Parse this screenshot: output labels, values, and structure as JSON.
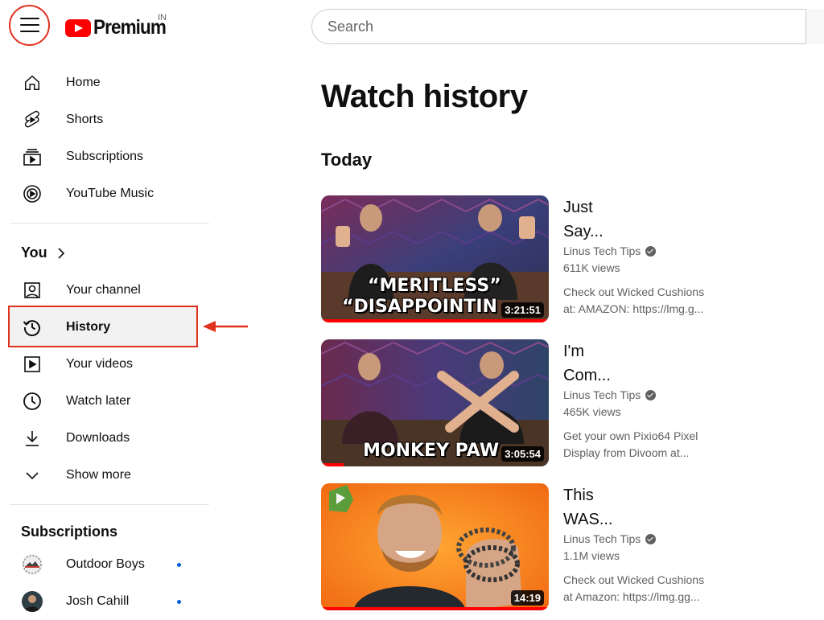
{
  "header": {
    "logo_text": "Premium",
    "country_code": "IN",
    "search_placeholder": "Search"
  },
  "sidebar": {
    "main_items": [
      {
        "label": "Home",
        "icon": "home-icon"
      },
      {
        "label": "Shorts",
        "icon": "shorts-icon"
      },
      {
        "label": "Subscriptions",
        "icon": "subscriptions-icon"
      },
      {
        "label": "YouTube Music",
        "icon": "youtube-music-icon"
      }
    ],
    "you_title": "You",
    "you_items": [
      {
        "label": "Your channel",
        "icon": "your-channel-icon"
      },
      {
        "label": "History",
        "icon": "history-icon"
      },
      {
        "label": "Your videos",
        "icon": "your-videos-icon"
      },
      {
        "label": "Watch later",
        "icon": "watch-later-icon"
      },
      {
        "label": "Downloads",
        "icon": "download-icon"
      },
      {
        "label": "Show more",
        "icon": "chevron-down-icon"
      }
    ],
    "subscriptions_title": "Subscriptions",
    "subscriptions": [
      {
        "name": "Outdoor Boys",
        "new_content": true
      },
      {
        "name": "Josh Cahill",
        "new_content": true
      }
    ]
  },
  "main": {
    "title": "Watch history",
    "group_label": "Today",
    "videos": [
      {
        "title_line1": "Just",
        "title_line2": "Say...",
        "channel": "Linus Tech Tips",
        "views": "611K views",
        "desc_line1": "Check out Wicked Cushions",
        "desc_line2": "at: AMAZON: https://lmg.g...",
        "duration": "3:21:51",
        "caption_line1": "“MERITLESS”",
        "caption_line2": "“DISAPPOINTIN",
        "progress": 1.0
      },
      {
        "title_line1": "I'm",
        "title_line2": "Com...",
        "channel": "Linus Tech Tips",
        "views": "465K views",
        "desc_line1": "Get your own Pixio64 Pixel",
        "desc_line2": "Display from Divoom at...",
        "duration": "3:05:54",
        "caption_line1": "MONKEY PAW",
        "caption_line2": "",
        "progress": 0.1
      },
      {
        "title_line1": "This",
        "title_line2": "WAS...",
        "channel": "Linus Tech Tips",
        "views": "1.1M views",
        "desc_line1": "Check out Wicked Cushions",
        "desc_line2": "at Amazon: https://lmg.gg...",
        "duration": "14:19",
        "caption_line1": "",
        "caption_line2": "",
        "progress": 1.0
      }
    ]
  },
  "colors": {
    "annotation_red": "#e0301e",
    "youtube_red": "#ff0000",
    "text_primary": "#0f0f0f",
    "text_secondary": "#606060",
    "new_dot": "#065fd4"
  }
}
